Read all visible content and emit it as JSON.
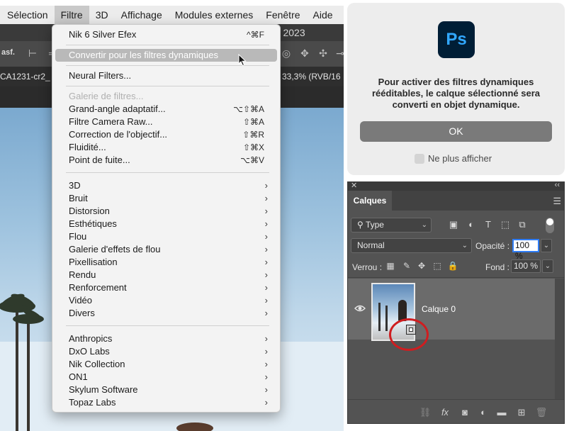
{
  "menubar": {
    "items": [
      "Sélection",
      "Filtre",
      "3D",
      "Affichage",
      "Modules externes",
      "Fenêtre",
      "Aide"
    ]
  },
  "titlebar": {
    "app_title": "op 2023"
  },
  "optionsbar": {
    "label": "asf."
  },
  "doctab": {
    "name": "CA1231-cr2_",
    "zoom": "33,3% (RVB/16"
  },
  "filter_menu": {
    "items": [
      {
        "label": "Nik 6 Silver Efex",
        "shortcut": "^⌘F"
      },
      {
        "label": "Convertir pour les filtres dynamiques",
        "highlighted": true
      },
      {
        "label": "Neural Filters..."
      },
      {
        "label": "Galerie de filtres...",
        "disabled": true
      },
      {
        "label": "Grand-angle adaptatif...",
        "shortcut": "⌥⇧⌘A"
      },
      {
        "label": "Filtre Camera Raw...",
        "shortcut": "⇧⌘A"
      },
      {
        "label": "Correction de l'objectif...",
        "shortcut": "⇧⌘R"
      },
      {
        "label": "Fluidité...",
        "shortcut": "⇧⌘X"
      },
      {
        "label": "Point de fuite...",
        "shortcut": "⌥⌘V"
      },
      {
        "label": "3D"
      },
      {
        "label": "Bruit"
      },
      {
        "label": "Distorsion"
      },
      {
        "label": "Esthétiques"
      },
      {
        "label": "Flou"
      },
      {
        "label": "Galerie d'effets de flou"
      },
      {
        "label": "Pixellisation"
      },
      {
        "label": "Rendu"
      },
      {
        "label": "Renforcement"
      },
      {
        "label": "Vidéo"
      },
      {
        "label": "Divers"
      },
      {
        "label": "Anthropics"
      },
      {
        "label": "DxO Labs"
      },
      {
        "label": "Nik Collection"
      },
      {
        "label": "ON1"
      },
      {
        "label": "Skylum Software"
      },
      {
        "label": "Topaz Labs"
      }
    ],
    "submenu_arrow": "›"
  },
  "dialog": {
    "logo_text": "Ps",
    "message": "Pour activer des filtres dynamiques rééditables, le calque sélectionné sera converti en objet dynamique.",
    "ok_label": "OK",
    "checkbox_label": "Ne plus afficher"
  },
  "layers_panel": {
    "tab": "Calques",
    "filter_type": "Type",
    "blend_mode": "Normal",
    "opacity_label": "Opacité :",
    "opacity_value": "100 %",
    "lock_label": "Verrou :",
    "fill_label": "Fond :",
    "fill_value": "100 %",
    "layer_name": "Calque 0",
    "fx_label": "fx"
  },
  "colors": {
    "highlight": "#b9b9b9",
    "ps_logo_bg": "#001e36",
    "ps_logo_fg": "#31a8ff",
    "annotation_circle": "#cf1d20",
    "opacity_focus": "#2f7df5"
  }
}
